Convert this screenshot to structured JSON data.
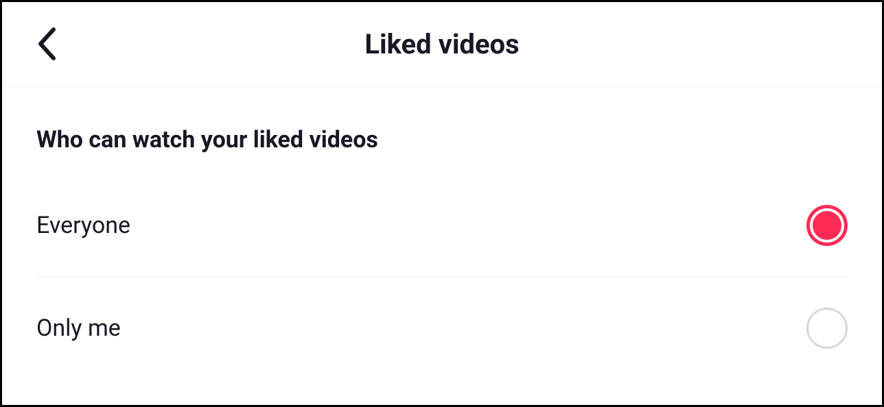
{
  "header": {
    "title": "Liked videos"
  },
  "section": {
    "heading": "Who can watch your liked videos"
  },
  "options": [
    {
      "label": "Everyone",
      "selected": true
    },
    {
      "label": "Only me",
      "selected": false
    }
  ],
  "colors": {
    "accent": "#fe2c55",
    "text": "#161823",
    "border": "#eeeeee",
    "radioBorder": "#d7d7d9"
  }
}
